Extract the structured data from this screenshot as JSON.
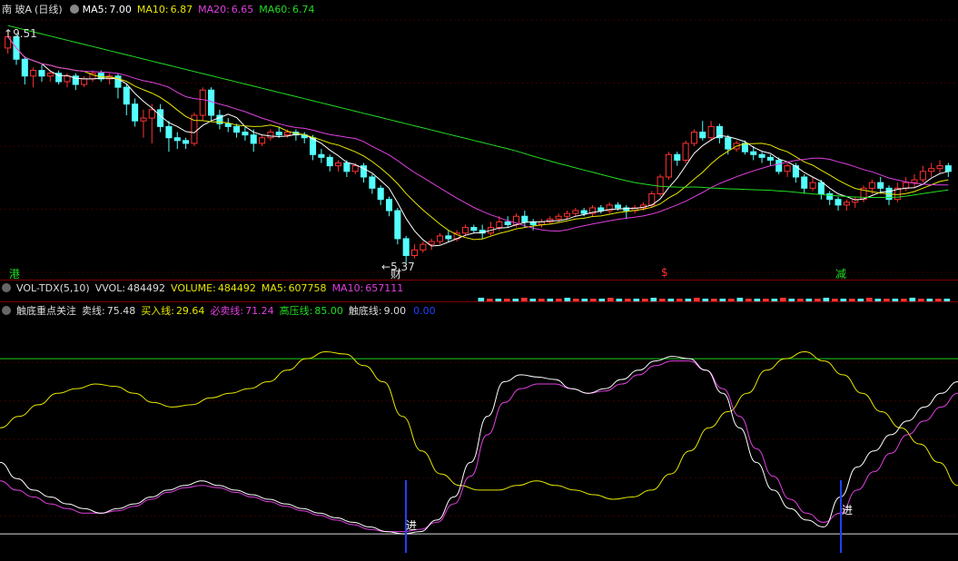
{
  "main": {
    "stock_name": "南 玻A",
    "period": "(日线)",
    "ma": [
      {
        "label": "MA5:",
        "value": "7.00",
        "color": "#ffffff"
      },
      {
        "label": "MA10:",
        "value": "6.87",
        "color": "#e6e600"
      },
      {
        "label": "MA20:",
        "value": "6.65",
        "color": "#e040e0"
      },
      {
        "label": "MA60:",
        "value": "6.74",
        "color": "#22dd22"
      }
    ],
    "high_label": "9.51",
    "low_label": "5.37",
    "markers": [
      {
        "text": "港",
        "color": "#22dd22"
      },
      {
        "text": "财",
        "color": "#e0e0e0"
      },
      {
        "text": "$",
        "color": "#ff3030"
      },
      {
        "text": "减",
        "color": "#22dd22"
      }
    ]
  },
  "volume": {
    "name": "VOL-TDX(5,10)",
    "items": [
      {
        "label": "VVOL:",
        "value": "484492",
        "color": "#dddddd"
      },
      {
        "label": "VOLUME:",
        "value": "484492",
        "color": "#e6e600"
      },
      {
        "label": "MA5:",
        "value": "607758",
        "color": "#e6e600"
      },
      {
        "label": "MA10:",
        "value": "657111",
        "color": "#e040e0"
      }
    ]
  },
  "indicator": {
    "name": "触底重点关注",
    "items": [
      {
        "label": "卖线:",
        "value": "75.48",
        "color": "#dddddd"
      },
      {
        "label": "买入线:",
        "value": "29.64",
        "color": "#e6e600"
      },
      {
        "label": "必卖线:",
        "value": "71.24",
        "color": "#e040e0"
      },
      {
        "label": "高压线:",
        "value": "85.00",
        "color": "#22dd22"
      },
      {
        "label": "触底线:",
        "value": "9.00",
        "color": "#dddddd"
      },
      {
        "label": "",
        "value": "0.00",
        "color": "#2040ff"
      }
    ],
    "signal_label": "进"
  },
  "chart_data": [
    {
      "type": "candlestick",
      "title": "南 玻A (日线)",
      "ylim": [
        5.2,
        9.7
      ],
      "high": 9.51,
      "low": 5.37,
      "ma_last": {
        "MA5": 7.0,
        "MA10": 6.87,
        "MA20": 6.65,
        "MA60": 6.74
      },
      "candles": [
        [
          9.2,
          9.4,
          9.51,
          9.1
        ],
        [
          9.4,
          9.0,
          9.45,
          8.9
        ],
        [
          9.0,
          8.7,
          9.05,
          8.55
        ],
        [
          8.7,
          8.8,
          8.85,
          8.5
        ],
        [
          8.8,
          8.7,
          8.9,
          8.6
        ],
        [
          8.7,
          8.75,
          8.8,
          8.6
        ],
        [
          8.75,
          8.6,
          8.8,
          8.55
        ],
        [
          8.6,
          8.7,
          8.75,
          8.5
        ],
        [
          8.7,
          8.55,
          8.75,
          8.45
        ],
        [
          8.55,
          8.65,
          8.7,
          8.5
        ],
        [
          8.65,
          8.75,
          8.8,
          8.6
        ],
        [
          8.75,
          8.65,
          8.8,
          8.6
        ],
        [
          8.65,
          8.7,
          8.75,
          8.55
        ],
        [
          8.7,
          8.5,
          8.75,
          8.3
        ],
        [
          8.5,
          8.2,
          8.55,
          8.0
        ],
        [
          8.2,
          7.9,
          8.3,
          7.8
        ],
        [
          7.9,
          7.95,
          8.1,
          7.6
        ],
        [
          7.95,
          8.1,
          8.2,
          7.5
        ],
        [
          8.1,
          7.8,
          8.2,
          7.7
        ],
        [
          7.8,
          7.6,
          7.9,
          7.35
        ],
        [
          7.6,
          7.55,
          7.7,
          7.4
        ],
        [
          7.55,
          7.5,
          7.6,
          7.4
        ],
        [
          7.5,
          8.0,
          8.05,
          7.45
        ],
        [
          8.0,
          8.45,
          8.5,
          7.9
        ],
        [
          8.45,
          8.0,
          8.5,
          7.9
        ],
        [
          8.0,
          7.85,
          8.1,
          7.75
        ],
        [
          7.85,
          7.8,
          7.95,
          7.7
        ],
        [
          7.8,
          7.7,
          7.85,
          7.6
        ],
        [
          7.7,
          7.65,
          7.8,
          7.55
        ],
        [
          7.65,
          7.5,
          7.75,
          7.35
        ],
        [
          7.5,
          7.6,
          7.65,
          7.45
        ],
        [
          7.6,
          7.7,
          7.75,
          7.55
        ],
        [
          7.7,
          7.65,
          7.8,
          7.6
        ],
        [
          7.65,
          7.7,
          7.75,
          7.6
        ],
        [
          7.7,
          7.65,
          7.75,
          7.55
        ],
        [
          7.65,
          7.6,
          7.7,
          7.5
        ],
        [
          7.6,
          7.3,
          7.65,
          7.2
        ],
        [
          7.3,
          7.25,
          7.4,
          7.15
        ],
        [
          7.25,
          7.1,
          7.3,
          7.0
        ],
        [
          7.1,
          7.15,
          7.2,
          7.0
        ],
        [
          7.15,
          7.0,
          7.2,
          6.9
        ],
        [
          7.0,
          7.1,
          7.15,
          6.95
        ],
        [
          7.1,
          6.9,
          7.15,
          6.8
        ],
        [
          6.9,
          6.7,
          6.95,
          6.6
        ],
        [
          6.7,
          6.5,
          6.75,
          6.4
        ],
        [
          6.5,
          6.3,
          6.55,
          6.2
        ],
        [
          6.3,
          5.8,
          6.35,
          5.7
        ],
        [
          5.8,
          5.5,
          5.85,
          5.37
        ],
        [
          5.5,
          5.6,
          5.7,
          5.45
        ],
        [
          5.6,
          5.7,
          5.75,
          5.55
        ],
        [
          5.7,
          5.75,
          5.8,
          5.6
        ],
        [
          5.75,
          5.85,
          5.9,
          5.7
        ],
        [
          5.85,
          5.8,
          5.95,
          5.75
        ],
        [
          5.8,
          5.9,
          5.95,
          5.75
        ],
        [
          5.9,
          6.0,
          6.05,
          5.85
        ],
        [
          6.0,
          5.95,
          6.05,
          5.9
        ],
        [
          5.95,
          5.9,
          6.05,
          5.8
        ],
        [
          5.9,
          6.0,
          6.1,
          5.85
        ],
        [
          6.0,
          6.1,
          6.2,
          5.95
        ],
        [
          6.1,
          6.05,
          6.2,
          6.0
        ],
        [
          6.05,
          6.2,
          6.25,
          6.0
        ],
        [
          6.2,
          6.1,
          6.3,
          6.0
        ],
        [
          6.1,
          6.05,
          6.15,
          5.95
        ],
        [
          6.05,
          6.1,
          6.15,
          6.0
        ],
        [
          6.1,
          6.15,
          6.2,
          6.05
        ],
        [
          6.15,
          6.2,
          6.25,
          6.1
        ],
        [
          6.2,
          6.25,
          6.3,
          6.15
        ],
        [
          6.25,
          6.3,
          6.35,
          6.2
        ],
        [
          6.3,
          6.25,
          6.35,
          6.2
        ],
        [
          6.25,
          6.35,
          6.4,
          6.2
        ],
        [
          6.35,
          6.3,
          6.4,
          6.25
        ],
        [
          6.3,
          6.4,
          6.45,
          6.25
        ],
        [
          6.4,
          6.35,
          6.45,
          6.3
        ],
        [
          6.35,
          6.3,
          6.4,
          6.15
        ],
        [
          6.3,
          6.35,
          6.4,
          6.25
        ],
        [
          6.35,
          6.4,
          6.45,
          6.3
        ],
        [
          6.4,
          6.6,
          6.65,
          6.35
        ],
        [
          6.6,
          6.9,
          6.95,
          6.55
        ],
        [
          6.9,
          7.3,
          7.35,
          6.85
        ],
        [
          7.3,
          7.2,
          7.35,
          7.1
        ],
        [
          7.2,
          7.5,
          7.55,
          7.15
        ],
        [
          7.5,
          7.7,
          7.75,
          7.45
        ],
        [
          7.7,
          7.6,
          7.9,
          7.55
        ],
        [
          7.6,
          7.8,
          7.9,
          7.55
        ],
        [
          7.8,
          7.6,
          7.85,
          7.5
        ],
        [
          7.6,
          7.4,
          7.65,
          7.3
        ],
        [
          7.4,
          7.5,
          7.55,
          7.35
        ],
        [
          7.5,
          7.35,
          7.55,
          7.3
        ],
        [
          7.35,
          7.3,
          7.45,
          7.2
        ],
        [
          7.3,
          7.25,
          7.35,
          7.15
        ],
        [
          7.25,
          7.2,
          7.3,
          7.1
        ],
        [
          7.2,
          7.0,
          7.25,
          6.95
        ],
        [
          7.0,
          7.1,
          7.15,
          6.9
        ],
        [
          7.1,
          6.9,
          7.15,
          6.8
        ],
        [
          6.9,
          6.7,
          6.95,
          6.6
        ],
        [
          6.7,
          6.8,
          6.9,
          6.65
        ],
        [
          6.8,
          6.6,
          6.85,
          6.5
        ],
        [
          6.6,
          6.5,
          6.65,
          6.4
        ],
        [
          6.5,
          6.4,
          6.55,
          6.3
        ],
        [
          6.4,
          6.45,
          6.5,
          6.3
        ],
        [
          6.45,
          6.5,
          6.55,
          6.35
        ],
        [
          6.5,
          6.7,
          6.75,
          6.45
        ],
        [
          6.7,
          6.8,
          6.85,
          6.6
        ],
        [
          6.8,
          6.7,
          6.9,
          6.6
        ],
        [
          6.7,
          6.5,
          6.75,
          6.4
        ],
        [
          6.5,
          6.7,
          6.8,
          6.45
        ],
        [
          6.7,
          6.8,
          6.9,
          6.65
        ],
        [
          6.8,
          6.85,
          6.95,
          6.7
        ],
        [
          6.85,
          7.0,
          7.1,
          6.8
        ],
        [
          7.0,
          7.05,
          7.15,
          6.9
        ],
        [
          7.05,
          7.1,
          7.2,
          6.95
        ],
        [
          7.1,
          7.0,
          7.15,
          6.9
        ]
      ]
    },
    {
      "type": "line",
      "title": "触底重点关注",
      "ylim": [
        0,
        100
      ],
      "reference_lines": {
        "高压线": 85.0,
        "触底线": 9.0
      },
      "series": [
        {
          "name": "卖线",
          "color": "#ffffff",
          "values": [
            40,
            33,
            28,
            25,
            22,
            20,
            18,
            20,
            22,
            25,
            28,
            30,
            32,
            30,
            28,
            26,
            24,
            22,
            20,
            18,
            16,
            14,
            12,
            10,
            9,
            10,
            15,
            25,
            40,
            60,
            75,
            78,
            77,
            76,
            72,
            70,
            72,
            76,
            80,
            84,
            86,
            85,
            80,
            70,
            55,
            40,
            28,
            20,
            15,
            12,
            25,
            38,
            45,
            52,
            58,
            64,
            70,
            75
          ]
        },
        {
          "name": "买入线",
          "color": "#e6e600",
          "values": [
            55,
            60,
            65,
            70,
            72,
            74,
            73,
            70,
            66,
            64,
            65,
            68,
            70,
            72,
            75,
            80,
            85,
            88,
            87,
            82,
            75,
            60,
            45,
            35,
            30,
            28,
            28,
            30,
            32,
            30,
            28,
            26,
            24,
            25,
            28,
            35,
            45,
            55,
            62,
            70,
            80,
            85,
            88,
            84,
            78,
            70,
            62,
            55,
            48,
            40,
            30
          ]
        },
        {
          "name": "必卖线",
          "color": "#e040e0",
          "values": [
            32,
            28,
            25,
            22,
            20,
            18,
            18,
            19,
            21,
            24,
            27,
            29,
            30,
            29,
            27,
            25,
            23,
            21,
            19,
            17,
            15,
            13,
            11,
            10,
            10,
            11,
            14,
            22,
            34,
            52,
            66,
            72,
            74,
            74,
            72,
            70,
            71,
            74,
            78,
            82,
            84,
            84,
            80,
            72,
            60,
            46,
            34,
            24,
            18,
            14,
            18,
            28,
            36,
            44,
            52,
            58,
            64,
            70
          ]
        }
      ],
      "signals": [
        {
          "text": "进"
        },
        {
          "text": "进"
        }
      ]
    }
  ]
}
